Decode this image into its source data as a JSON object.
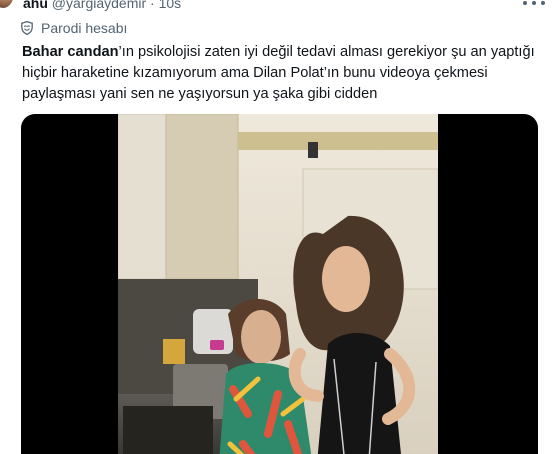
{
  "tweet": {
    "display_name": "ahu",
    "handle": "@yargiaydemir",
    "separator": "·",
    "time": "10s",
    "label": "Parodi hesabı",
    "text_bold_1": "Bahar candan",
    "text_1": "’ın psikolojisi zaten iyi değil tedavi alması gerekiyor şu an yaptığı hiçbir haraketine kızamıyorum ama Dilan Polat’ın bunu videoya çekmesi paylaşması yani sen ne yaşıyorsun ya şaka gibi cidden"
  },
  "icons": {
    "label_icon": "shield-icon",
    "more_icon": "more-horizontal-icon"
  },
  "colors": {
    "text_primary": "#0f1419",
    "text_secondary": "#536471",
    "media_background": "#000000"
  }
}
